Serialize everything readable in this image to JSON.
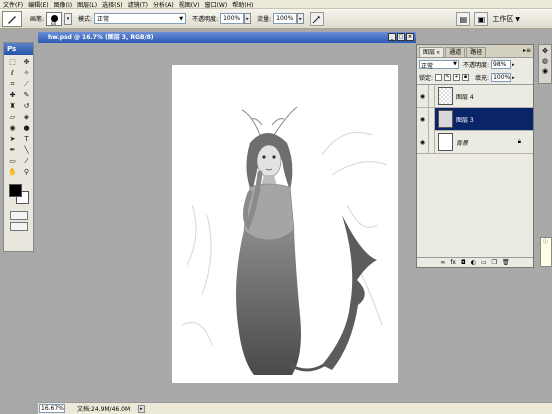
{
  "menu": [
    "文件(F)",
    "编辑(E)",
    "图像(I)",
    "图层(L)",
    "选择(S)",
    "滤镜(T)",
    "分析(A)",
    "视图(V)",
    "窗口(W)",
    "帮助(H)"
  ],
  "options": {
    "brush_label": "画笔:",
    "brush_size": "60",
    "mode_label": "模式:",
    "mode_value": "正常",
    "opacity_label": "不透明度:",
    "opacity_value": "100%",
    "flow_label": "流量:",
    "flow_value": "100%",
    "workspace_label": "工作区"
  },
  "toolbox": {
    "title": "Ps"
  },
  "document": {
    "title": "hw.psd @ 16.7% (图层 3, RGB/8)"
  },
  "status": {
    "zoom": "16.67%",
    "doc_info": "文档:24.9M/46.0M"
  },
  "layers_panel": {
    "tabs": [
      "图层",
      "通道",
      "路径"
    ],
    "blend_mode": "正常",
    "opacity_label": "不透明度:",
    "opacity_value": "98%",
    "lock_label": "锁定:",
    "fill_label": "填充:",
    "fill_value": "100%",
    "layers": [
      {
        "name": "图层 4",
        "active": false,
        "locked": false
      },
      {
        "name": "图层 3",
        "active": true,
        "locked": false
      },
      {
        "name": "背景",
        "active": false,
        "locked": true
      }
    ],
    "bottom_icons": [
      "fx"
    ]
  },
  "colors": {
    "title_bar": "#2b59b3",
    "active_layer": "#0a246a",
    "canvas_bg": "#a9a9a9"
  }
}
